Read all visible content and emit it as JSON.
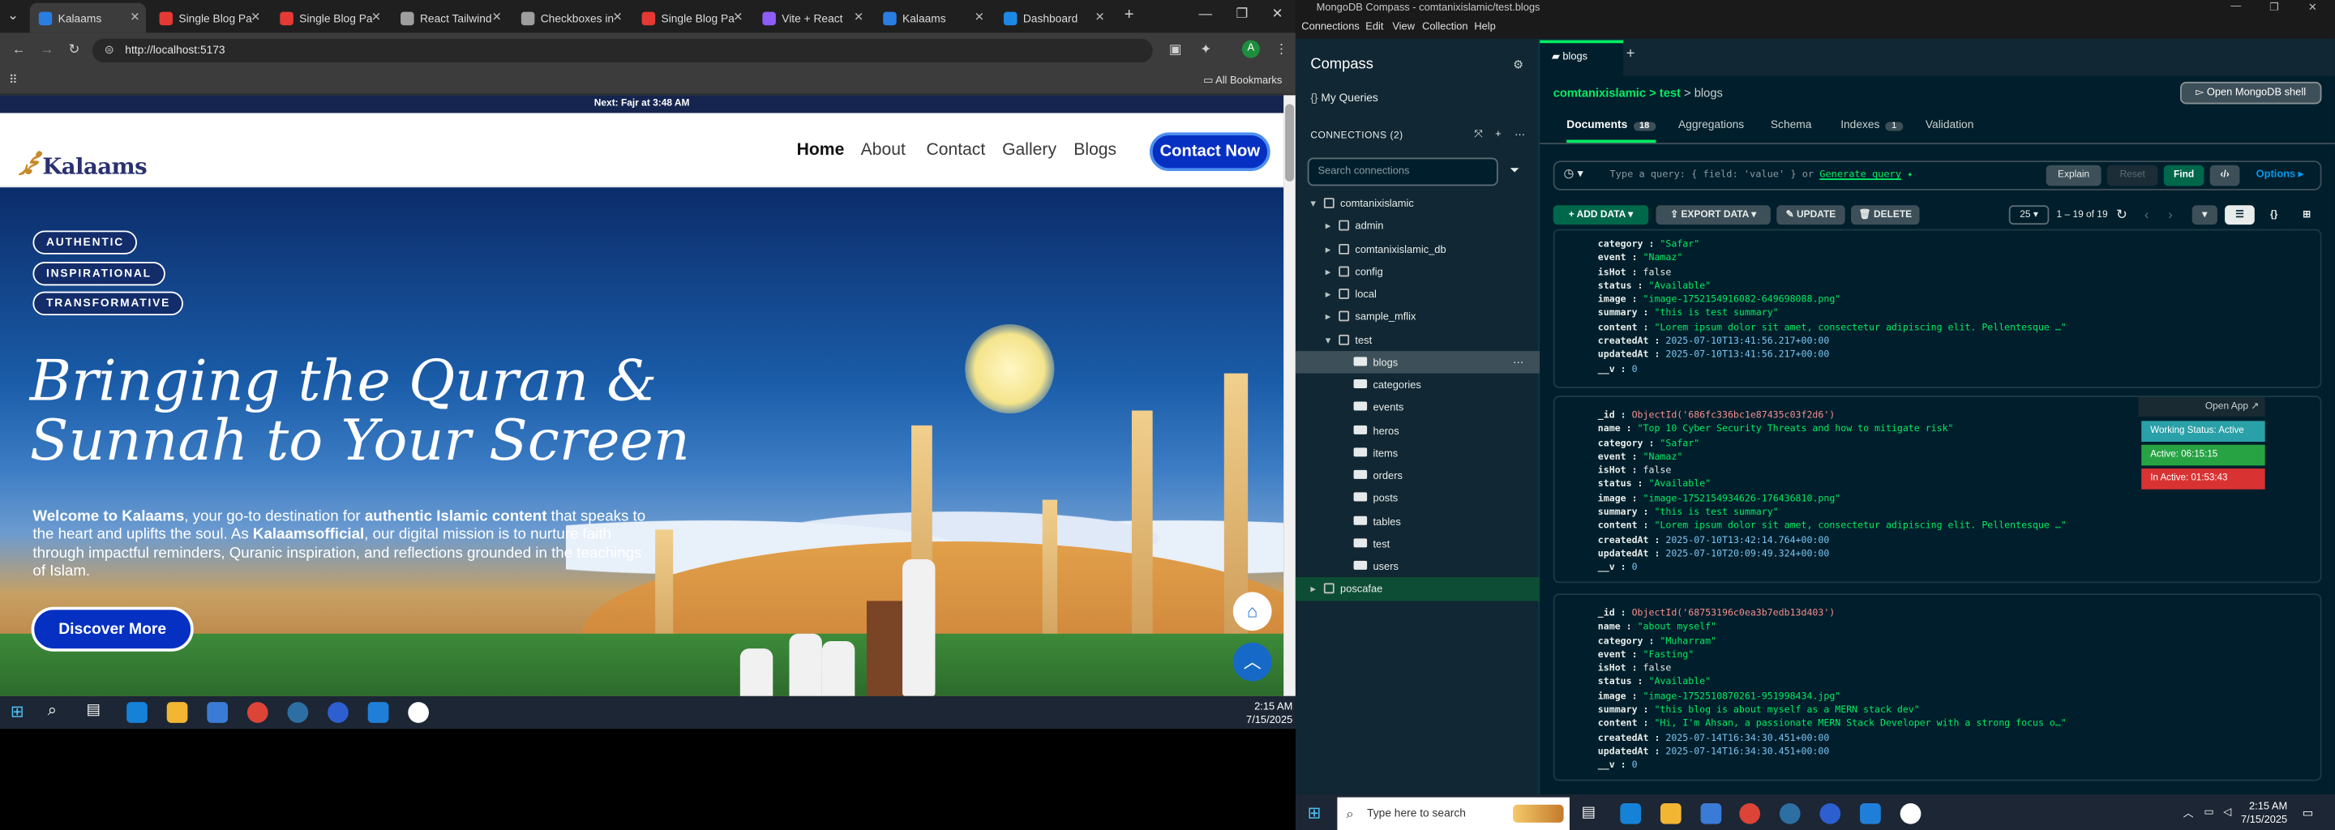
{
  "browser": {
    "tabs": [
      {
        "label": "Kalaams",
        "active": true,
        "fav_color": "#2a7de1"
      },
      {
        "label": "Single Blog Pa",
        "fav_color": "#e53935"
      },
      {
        "label": "Single Blog Pa",
        "fav_color": "#e53935"
      },
      {
        "label": "React Tailwind",
        "fav_color": "#9e9e9e"
      },
      {
        "label": "Checkboxes in",
        "fav_color": "#9e9e9e"
      },
      {
        "label": "Single Blog Pa",
        "fav_color": "#e53935"
      },
      {
        "label": "Vite + React",
        "fav_color": "#8e5cf7"
      },
      {
        "label": "Kalaams",
        "fav_color": "#2a7de1"
      },
      {
        "label": "Dashboard",
        "fav_color": "#1e88e5"
      }
    ],
    "url": "http://localhost:5173",
    "all_bookmarks": "All Bookmarks",
    "add_tab": "+",
    "profile_initial": "A"
  },
  "site": {
    "notice": "Next: Fajr at 3:48 AM",
    "logo": "Kalaams",
    "nav": [
      "Home",
      "About",
      "Contact",
      "Gallery",
      "Blogs"
    ],
    "contact_button": "Contact Now",
    "badges": [
      "AUTHENTIC",
      "INSPIRATIONAL",
      "TRANSFORMATIVE"
    ],
    "title_line1": "Bringing the Quran &",
    "title_line2": "Sunnah to Your Screen",
    "intro": {
      "p1": "Welcome to Kalaams",
      "p2": ", your go-to destination for ",
      "p3": "authentic Islamic content",
      "p4": " that speaks to the heart and uplifts the soul. As ",
      "p5": "Kalaamsofficial",
      "p6": ", our digital mission is to nurture faith through impactful reminders, Quranic inspiration, and reflections grounded in the teachings of Islam."
    },
    "discover_button": "Discover More"
  },
  "left_taskbar": {
    "time": "2:15 AM",
    "date": "7/15/2025"
  },
  "compass": {
    "window_title": "MongoDB Compass - comtanixislamic/test.blogs",
    "menu": [
      "Connections",
      "Edit",
      "View",
      "Collection",
      "Help"
    ],
    "brand": "Compass",
    "my_queries": "My Queries",
    "connections_label": "CONNECTIONS (2)",
    "search_placeholder": "Search connections",
    "tree": [
      {
        "label": "comtanixislamic",
        "level": 0,
        "type": "conn",
        "open": true
      },
      {
        "label": "admin",
        "level": 1,
        "type": "db"
      },
      {
        "label": "comtanixislamic_db",
        "level": 1,
        "type": "db"
      },
      {
        "label": "config",
        "level": 1,
        "type": "db"
      },
      {
        "label": "local",
        "level": 1,
        "type": "db"
      },
      {
        "label": "sample_mflix",
        "level": 1,
        "type": "db"
      },
      {
        "label": "test",
        "level": 1,
        "type": "db",
        "open": true
      },
      {
        "label": "blogs",
        "level": 2,
        "type": "coll",
        "selected": true
      },
      {
        "label": "categories",
        "level": 2,
        "type": "coll"
      },
      {
        "label": "events",
        "level": 2,
        "type": "coll"
      },
      {
        "label": "heros",
        "level": 2,
        "type": "coll"
      },
      {
        "label": "items",
        "level": 2,
        "type": "coll"
      },
      {
        "label": "orders",
        "level": 2,
        "type": "coll"
      },
      {
        "label": "posts",
        "level": 2,
        "type": "coll"
      },
      {
        "label": "tables",
        "level": 2,
        "type": "coll"
      },
      {
        "label": "test",
        "level": 2,
        "type": "coll"
      },
      {
        "label": "users",
        "level": 2,
        "type": "coll"
      },
      {
        "label": "poscafae",
        "level": 0,
        "type": "conn"
      }
    ],
    "tab_name": "blogs",
    "breadcrumb": [
      "comtanixislamic",
      "test",
      "blogs"
    ],
    "open_shell": "Open MongoDB shell",
    "subtabs": [
      {
        "label": "Documents",
        "count": "18",
        "active": true
      },
      {
        "label": "Aggregations"
      },
      {
        "label": "Schema"
      },
      {
        "label": "Indexes",
        "count": "1"
      },
      {
        "label": "Validation"
      }
    ],
    "query_placeholder": "Type a query: { field: 'value' } or",
    "generate_query": "Generate query",
    "explain": "Explain",
    "reset": "Reset",
    "find": "Find",
    "options": "Options",
    "add_data": "ADD DATA",
    "export_data": "EXPORT DATA",
    "update": "UPDATE",
    "delete": "DELETE",
    "page_size": "25",
    "range": "1 – 19 of 19",
    "documents": [
      {
        "rows": [
          [
            "category",
            "\"Safar\"",
            "vs"
          ],
          [
            "event",
            "\"Namaz\"",
            "vs"
          ],
          [
            "isHot",
            "false",
            "vb"
          ],
          [
            "status",
            "\"Available\"",
            "vs"
          ],
          [
            "image",
            "\"image-1752154916082-649698088.png\"",
            "vs"
          ],
          [
            "summary",
            "\"this is test summary\"",
            "vs"
          ],
          [
            "content",
            "\"Lorem ipsum dolor sit amet, consectetur adipiscing elit. Pellentesque …\"",
            "vs"
          ],
          [
            "createdAt",
            "2025-07-10T13:41:56.217+00:00",
            "vd"
          ],
          [
            "updatedAt",
            "2025-07-10T13:41:56.217+00:00",
            "vd"
          ],
          [
            "__v",
            "0",
            "vn"
          ]
        ]
      },
      {
        "rows": [
          [
            "_id",
            "ObjectId('686fc336bc1e87435c03f2d6')",
            "vo"
          ],
          [
            "name",
            "\"Top 10 Cyber Security Threats and how to mitigate risk\"",
            "vs"
          ],
          [
            "category",
            "\"Safar\"",
            "vs"
          ],
          [
            "event",
            "\"Namaz\"",
            "vs"
          ],
          [
            "isHot",
            "false",
            "vb"
          ],
          [
            "status",
            "\"Available\"",
            "vs"
          ],
          [
            "image",
            "\"image-1752154934626-176436810.png\"",
            "vs"
          ],
          [
            "summary",
            "\"this is test summary\"",
            "vs"
          ],
          [
            "content",
            "\"Lorem ipsum dolor sit amet, consectetur adipiscing elit. Pellentesque …\"",
            "vs"
          ],
          [
            "createdAt",
            "2025-07-10T13:42:14.764+00:00",
            "vd"
          ],
          [
            "updatedAt",
            "2025-07-10T20:09:49.324+00:00",
            "vd"
          ],
          [
            "__v",
            "0",
            "vn"
          ]
        ]
      },
      {
        "rows": [
          [
            "_id",
            "ObjectId('68753196c0ea3b7edb13d403')",
            "vo"
          ],
          [
            "name",
            "\"about myself\"",
            "vs"
          ],
          [
            "category",
            "\"Muharram\"",
            "vs"
          ],
          [
            "event",
            "\"Fasting\"",
            "vs"
          ],
          [
            "isHot",
            "false",
            "vb"
          ],
          [
            "status",
            "\"Available\"",
            "vs"
          ],
          [
            "image",
            "\"image-1752510870261-951998434.jpg\"",
            "vs"
          ],
          [
            "summary",
            "\"this blog is about myself as a MERN stack dev\"",
            "vs"
          ],
          [
            "content",
            "\"Hi, I'm Ahsan, a passionate MERN Stack Developer with a strong focus o…\"",
            "vs"
          ],
          [
            "createdAt",
            "2025-07-14T16:34:30.451+00:00",
            "vd"
          ],
          [
            "updatedAt",
            "2025-07-14T16:34:30.451+00:00",
            "vd"
          ],
          [
            "__v",
            "0",
            "vn"
          ]
        ]
      }
    ],
    "work_status": {
      "open_app": "Open App ↗",
      "status": "Working Status: Active",
      "active": "Active: 06:15:15",
      "inactive": "In Active: 01:53:43"
    }
  },
  "right_taskbar": {
    "search": "Type here to search",
    "time": "2:15 AM",
    "date": "7/15/2025"
  }
}
